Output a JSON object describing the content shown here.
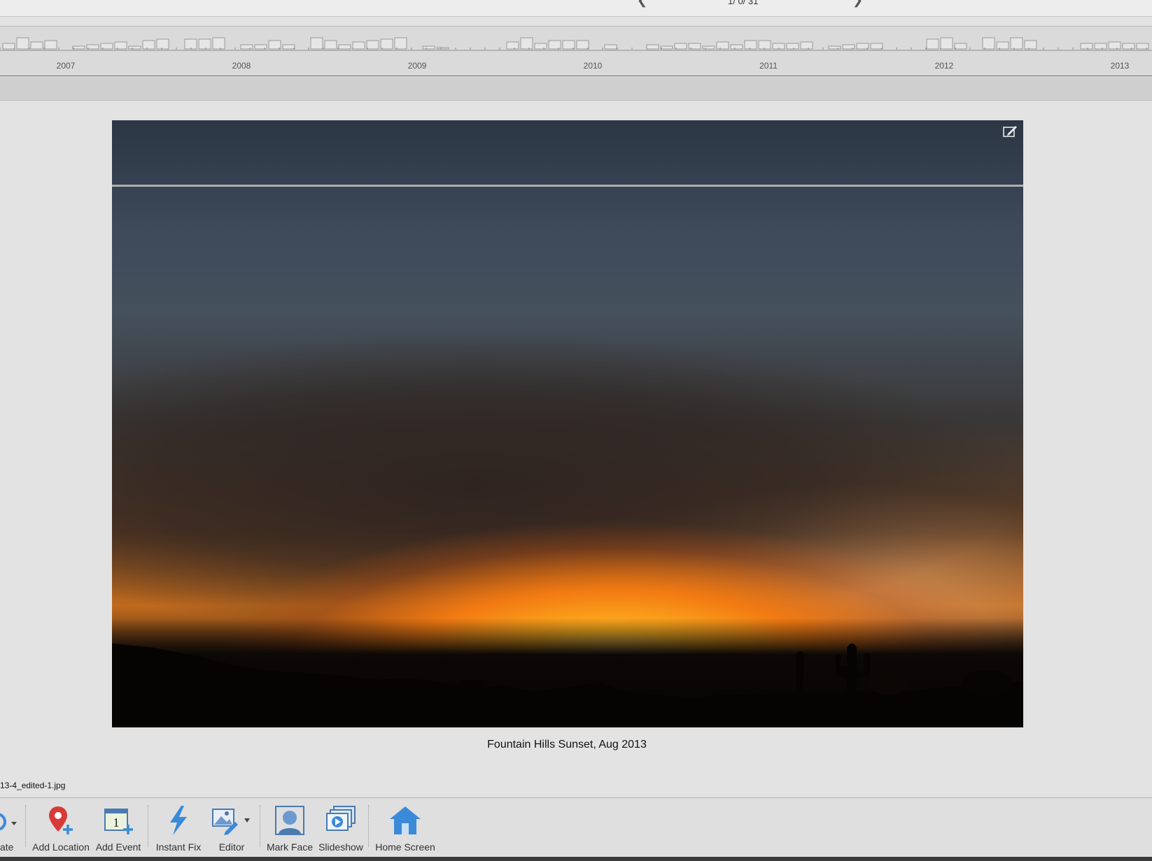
{
  "nav": {
    "counter": "1/ 0/ 31",
    "prev_glyph": "❮",
    "next_glyph": "❯"
  },
  "timeline": {
    "years": [
      "2007",
      "2008",
      "2009",
      "2010",
      "2011",
      "2012",
      "2013"
    ]
  },
  "photo": {
    "caption": "Fountain Hills Sunset, Aug 2013",
    "filename": "13-4_edited-1.jpg"
  },
  "toolbar": {
    "rotate_label": "ate",
    "add_location_label": "Add Location",
    "add_event_label": "Add Event",
    "instant_fix_label": "Instant Fix",
    "editor_label": "Editor",
    "mark_face_label": "Mark Face",
    "slideshow_label": "Slideshow",
    "home_screen_label": "Home Screen"
  },
  "colors": {
    "accent_blue": "#3a8ad8",
    "location_red": "#d83a3a",
    "event_green": "#6ab04c"
  }
}
